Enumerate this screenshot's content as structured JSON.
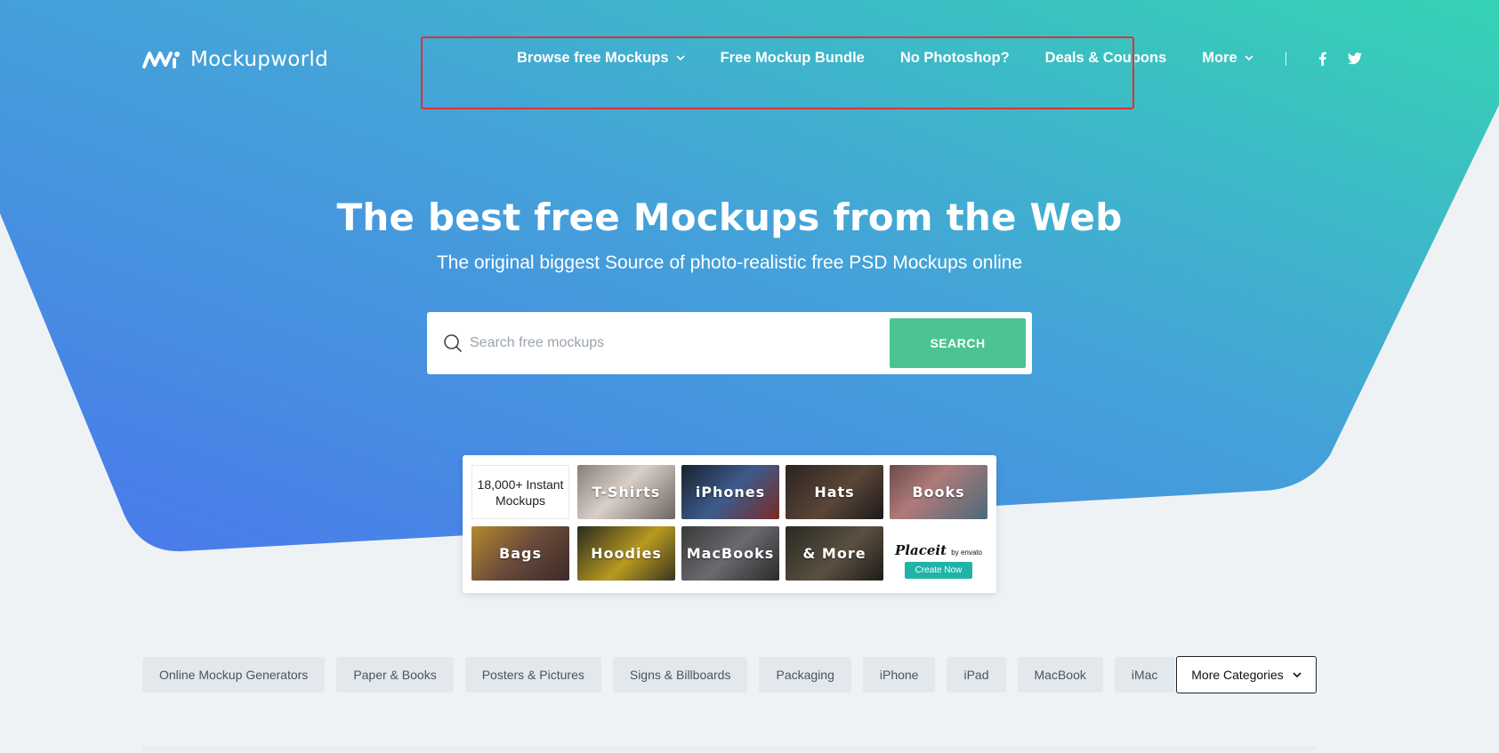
{
  "header": {
    "logo_text": "Mockupworld",
    "nav": [
      {
        "label": "Browse free Mockups",
        "has_dropdown": true
      },
      {
        "label": "Free Mockup Bundle",
        "has_dropdown": false
      },
      {
        "label": "No Photoshop?",
        "has_dropdown": false
      },
      {
        "label": "Deals & Coupons",
        "has_dropdown": false
      },
      {
        "label": "More",
        "has_dropdown": true
      }
    ],
    "social_icons": [
      "facebook-icon",
      "twitter-icon"
    ]
  },
  "hero": {
    "title": "The best free Mockups from the Web",
    "subtitle": "The original biggest Source of photo-realistic free PSD Mockups online"
  },
  "search": {
    "placeholder": "Search free mockups",
    "button_label": "SEARCH"
  },
  "placeit_widget": {
    "instant_line1": "18,000+ Instant",
    "instant_line2": "Mockups",
    "tiles": [
      "T-Shirts",
      "iPhones",
      "Hats",
      "Books",
      "Bags",
      "Hoodies",
      "MacBooks",
      "& More"
    ],
    "brand": "Placeit",
    "brand_suffix": "by envato",
    "cta_label": "Create Now"
  },
  "categories": [
    "Online Mockup Generators",
    "Paper & Books",
    "Posters & Pictures",
    "Signs & Billboards",
    "Packaging",
    "iPhone",
    "iPad",
    "MacBook",
    "iMac"
  ],
  "more_categories_label": "More Categories",
  "colors": {
    "gradient_start": "#4a7fe8",
    "gradient_end": "#36cfb6",
    "search_button": "#4cc491",
    "placeit_button": "#20b3a8",
    "highlight_box": "#e03131"
  }
}
